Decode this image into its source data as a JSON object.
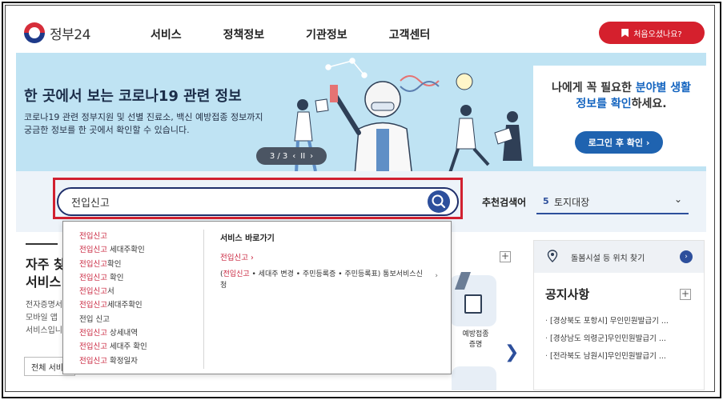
{
  "header": {
    "logo_text": "정부24",
    "nav": [
      "서비스",
      "정책정보",
      "기관정보",
      "고객센터"
    ],
    "first_visit_label": "처음오셨나요?"
  },
  "banner": {
    "title": "한 곳에서 보는 코로나19 관련 정보",
    "desc_line1": "코로나19 관련 정부지원 및 선별 진료소, 백신 예방접종 정보까지",
    "desc_line2": "궁금한 정보를 한 곳에서 확인할 수 있습니다.",
    "pager": "3 / 3",
    "pager_prev": "‹",
    "pager_next": "›",
    "pager_pause": "II",
    "login_line1_a": "나에게 꼭 필요한 ",
    "login_line1_b": "분야별 생활",
    "login_line2_a": "정보를 확인",
    "login_line2_b": "하세요.",
    "login_button": "로그인 후 확인 ›"
  },
  "search": {
    "value": "전입신고",
    "recommend_label": "추천검색어",
    "recommend_num": "5",
    "recommend_value": "토지대장",
    "colors": {
      "outline": "#d12030",
      "accent": "#2d4f9c"
    }
  },
  "suggestions": {
    "keyword": "전입신고",
    "items": [
      {
        "kw": "전입신고",
        "rest": ""
      },
      {
        "kw": "전입신고",
        "rest": " 세대주확인"
      },
      {
        "kw": "전입신고",
        "rest": "확인"
      },
      {
        "kw": "전입신고",
        "rest": " 확인"
      },
      {
        "kw": "전입신고",
        "rest": "서"
      },
      {
        "kw": "전입신고",
        "rest": "세대주확인"
      },
      {
        "kw": "",
        "rest": "전입 신고"
      },
      {
        "kw": "전입신고",
        "rest": " 상세내역"
      },
      {
        "kw": "전입신고",
        "rest": " 세대주 확인"
      },
      {
        "kw": "전입신고",
        "rest": " 확정일자"
      }
    ],
    "shortcut_heading": "서비스 바로가기",
    "shortcut_link1": "전입신고  ›",
    "shortcut_link2_open": "(",
    "shortcut_link2_kw": "전입신고",
    "shortcut_link2_rest": " • 세대주 변경 • 주민등록증 • 주민등록표) 통보서비스신청",
    "shortcut_link2_arrow": "›"
  },
  "left_panel": {
    "title_line1": "자주 찾",
    "title_line2": "서비스",
    "desc_line1": "전자증명서",
    "desc_line2": "모바일 앱",
    "desc_line3": "서비스입니",
    "button": "전체 서비"
  },
  "mid_panel": {
    "plus": "+",
    "service_label_line1": "예방접종",
    "service_label_line2": "증명",
    "next": "❯"
  },
  "right_panel": {
    "location_label": "돌봄시설 등 위치 찾기",
    "location_go": "›",
    "notice_title": "공지사항",
    "notice_plus": "+",
    "notices": [
      "[경상북도 포항시] 무인민원발급기 ...",
      "[경상남도 의령군]무인민원발급기 ...",
      "[전라북도 남원시]무인민원발급기 ..."
    ]
  }
}
